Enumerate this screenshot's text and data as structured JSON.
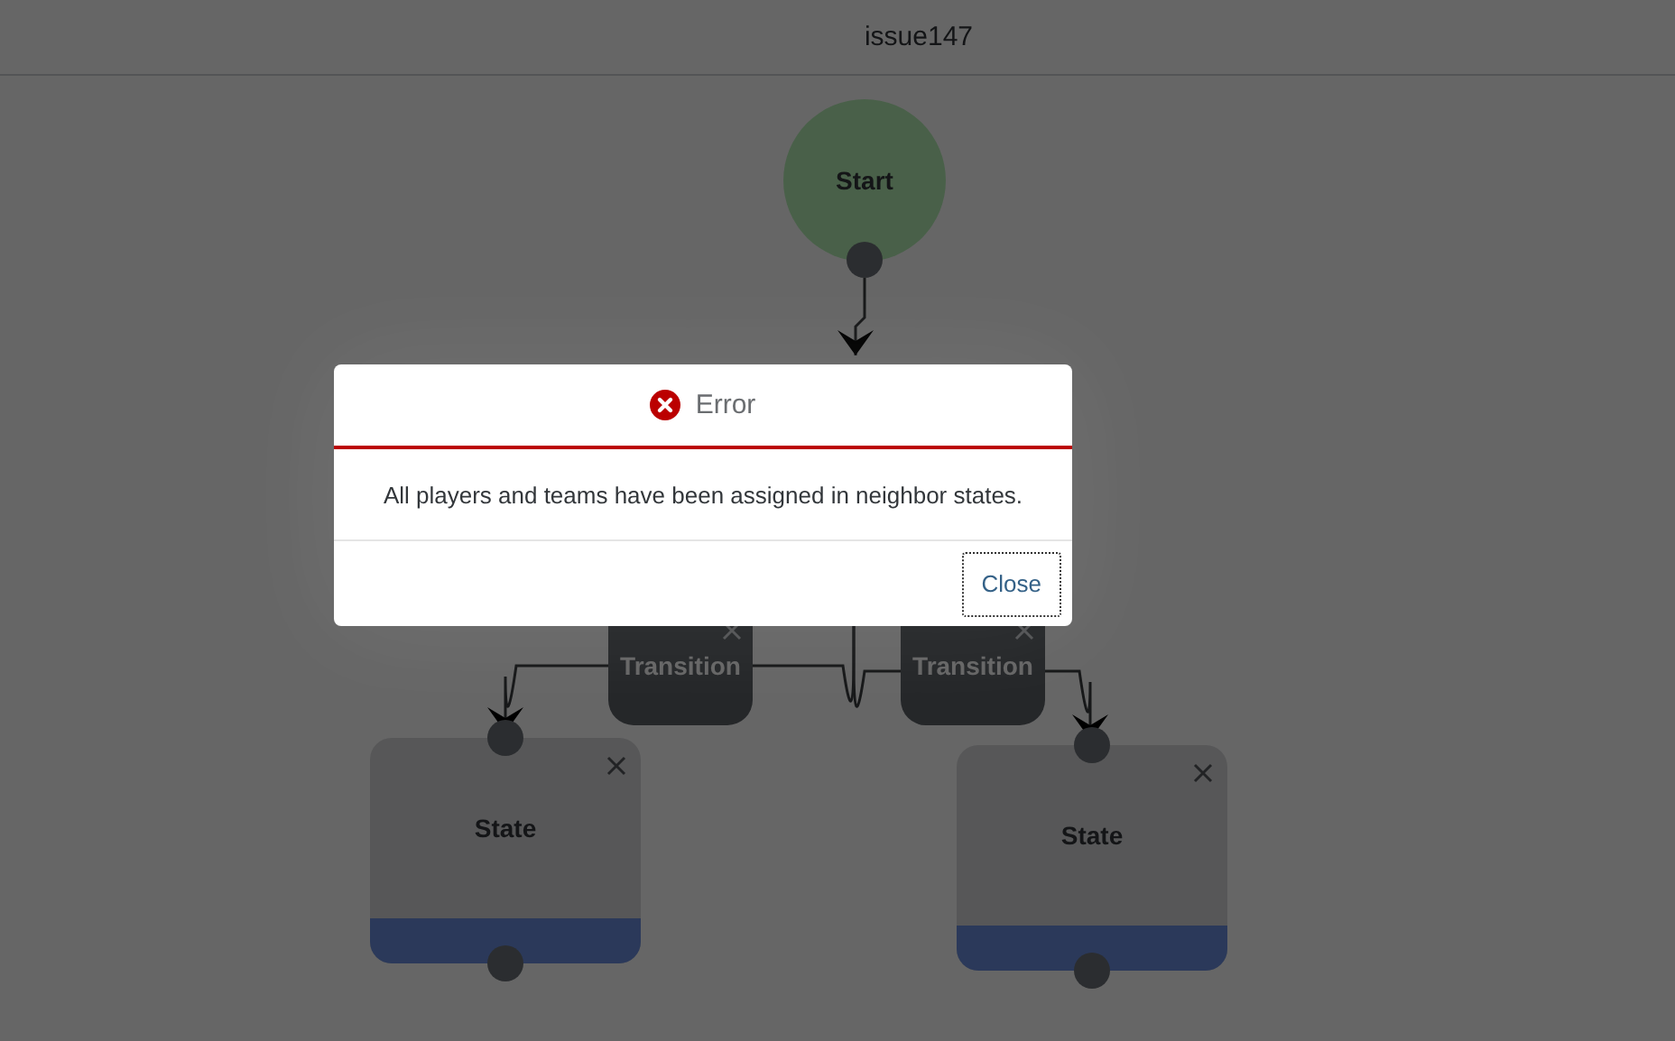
{
  "header": {
    "title": "issue147"
  },
  "diagram": {
    "nodes": [
      {
        "kind": "start",
        "label": "Start"
      },
      {
        "kind": "transition",
        "label": "Transition"
      },
      {
        "kind": "transition",
        "label": "Transition"
      },
      {
        "kind": "state",
        "label": "State"
      },
      {
        "kind": "state",
        "label": "State"
      }
    ]
  },
  "dialog": {
    "title": "Error",
    "message": "All players and teams have been assigned in neighbor states.",
    "buttons": [
      "Close"
    ]
  }
}
